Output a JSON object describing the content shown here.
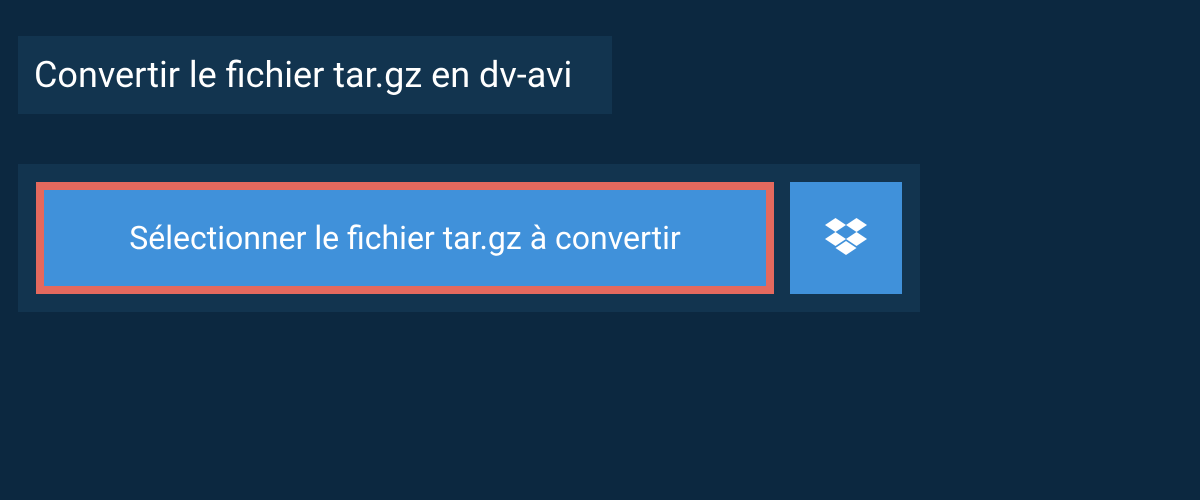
{
  "title": "Convertir le fichier tar.gz en dv-avi",
  "select_button_label": "Sélectionner le fichier tar.gz à convertir"
}
